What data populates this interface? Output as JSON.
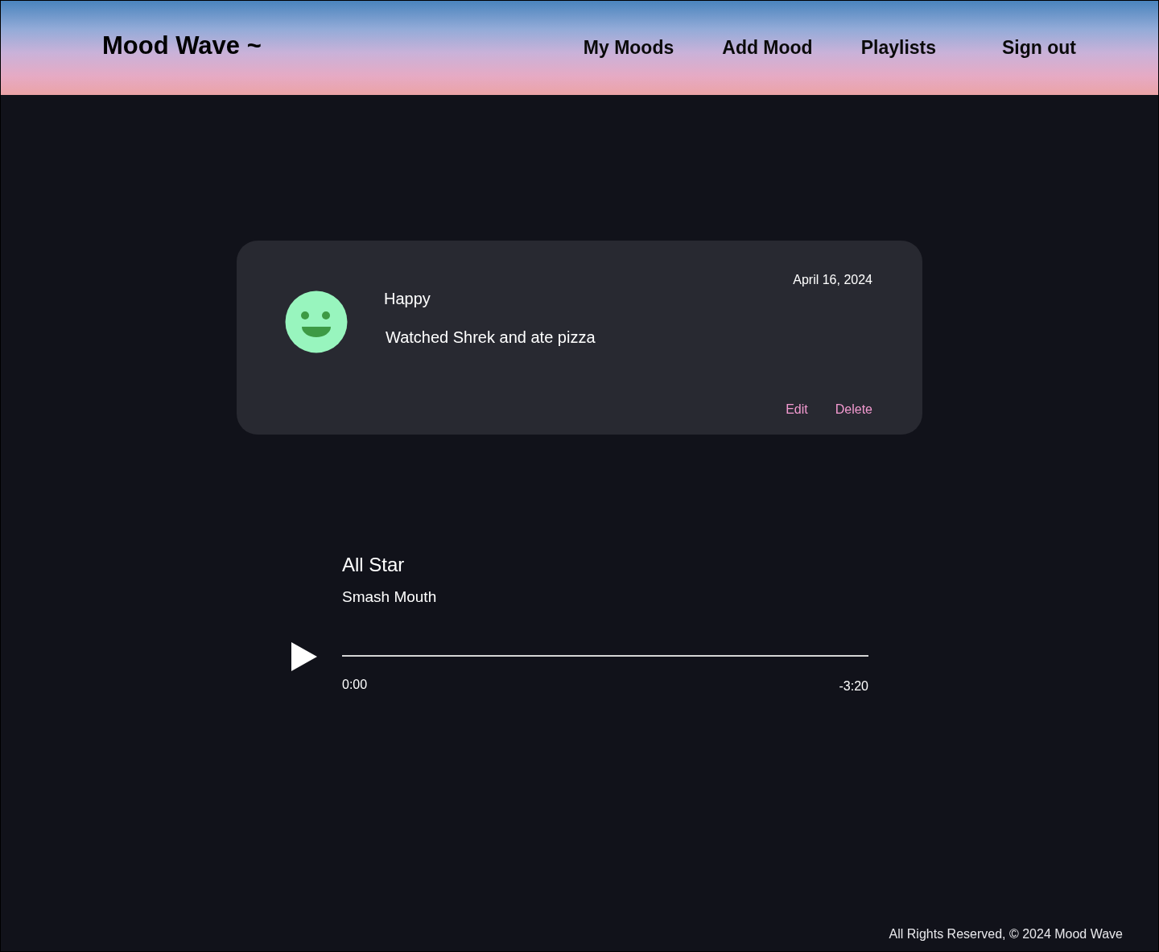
{
  "header": {
    "logo": "Mood Wave ~",
    "nav": [
      {
        "label": "My Moods"
      },
      {
        "label": "Add Mood"
      },
      {
        "label": "Playlists"
      },
      {
        "label": "Sign out"
      }
    ]
  },
  "mood_card": {
    "mood": "Happy",
    "kind": "happy",
    "color": "#98f5be",
    "note": "Watched Shrek and ate pizza",
    "date": "April 16, 2024",
    "actions": [
      "Edit",
      "Delete"
    ]
  },
  "player": {
    "title": "All Star",
    "artist": "Smash Mouth",
    "level": 0,
    "elapsed": "0:00",
    "remaining": "-3:20"
  },
  "footer": {
    "text": "All Rights Reserved, © 2024 Mood Wave"
  }
}
